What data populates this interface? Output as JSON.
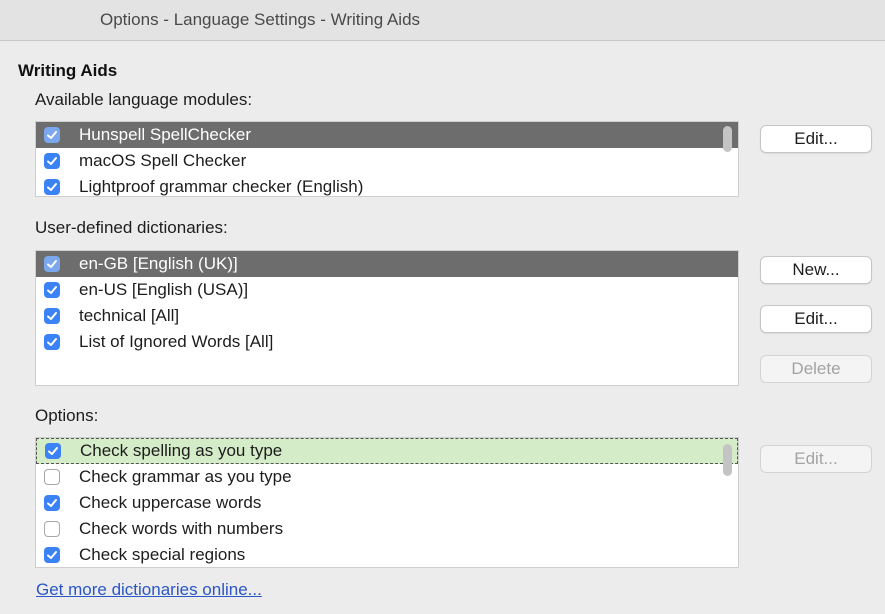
{
  "window": {
    "title": "Options - Language Settings - Writing Aids"
  },
  "section_title": "Writing Aids",
  "modules": {
    "label": "Available language modules:",
    "items": [
      {
        "label": "Hunspell SpellChecker",
        "checked": true,
        "selected": true
      },
      {
        "label": "macOS Spell Checker",
        "checked": true
      },
      {
        "label": "Lightproof grammar checker (English)",
        "checked": true
      }
    ],
    "edit_label": "Edit..."
  },
  "dictionaries": {
    "label": "User-defined dictionaries:",
    "items": [
      {
        "label": "en-GB [English (UK)]",
        "checked": true,
        "selected": true
      },
      {
        "label": "en-US [English (USA)]",
        "checked": true
      },
      {
        "label": "technical [All]",
        "checked": true
      },
      {
        "label": "List of Ignored Words [All]",
        "checked": true
      }
    ],
    "new_label": "New...",
    "edit_label": "Edit...",
    "delete_label": "Delete"
  },
  "options": {
    "label": "Options:",
    "items": [
      {
        "label": "Check spelling as you type",
        "checked": true,
        "focused": true
      },
      {
        "label": "Check grammar as you type",
        "checked": false
      },
      {
        "label": "Check uppercase words",
        "checked": true
      },
      {
        "label": "Check words with numbers",
        "checked": false
      },
      {
        "label": "Check special regions",
        "checked": true
      }
    ],
    "edit_label": "Edit..."
  },
  "link": {
    "label": "Get more dictionaries online..."
  },
  "colors": {
    "checkbox_accent": "#3b82f6",
    "selection": "#6d6d6d",
    "focus_row": "#d5ecc8",
    "link": "#2a56c6"
  }
}
